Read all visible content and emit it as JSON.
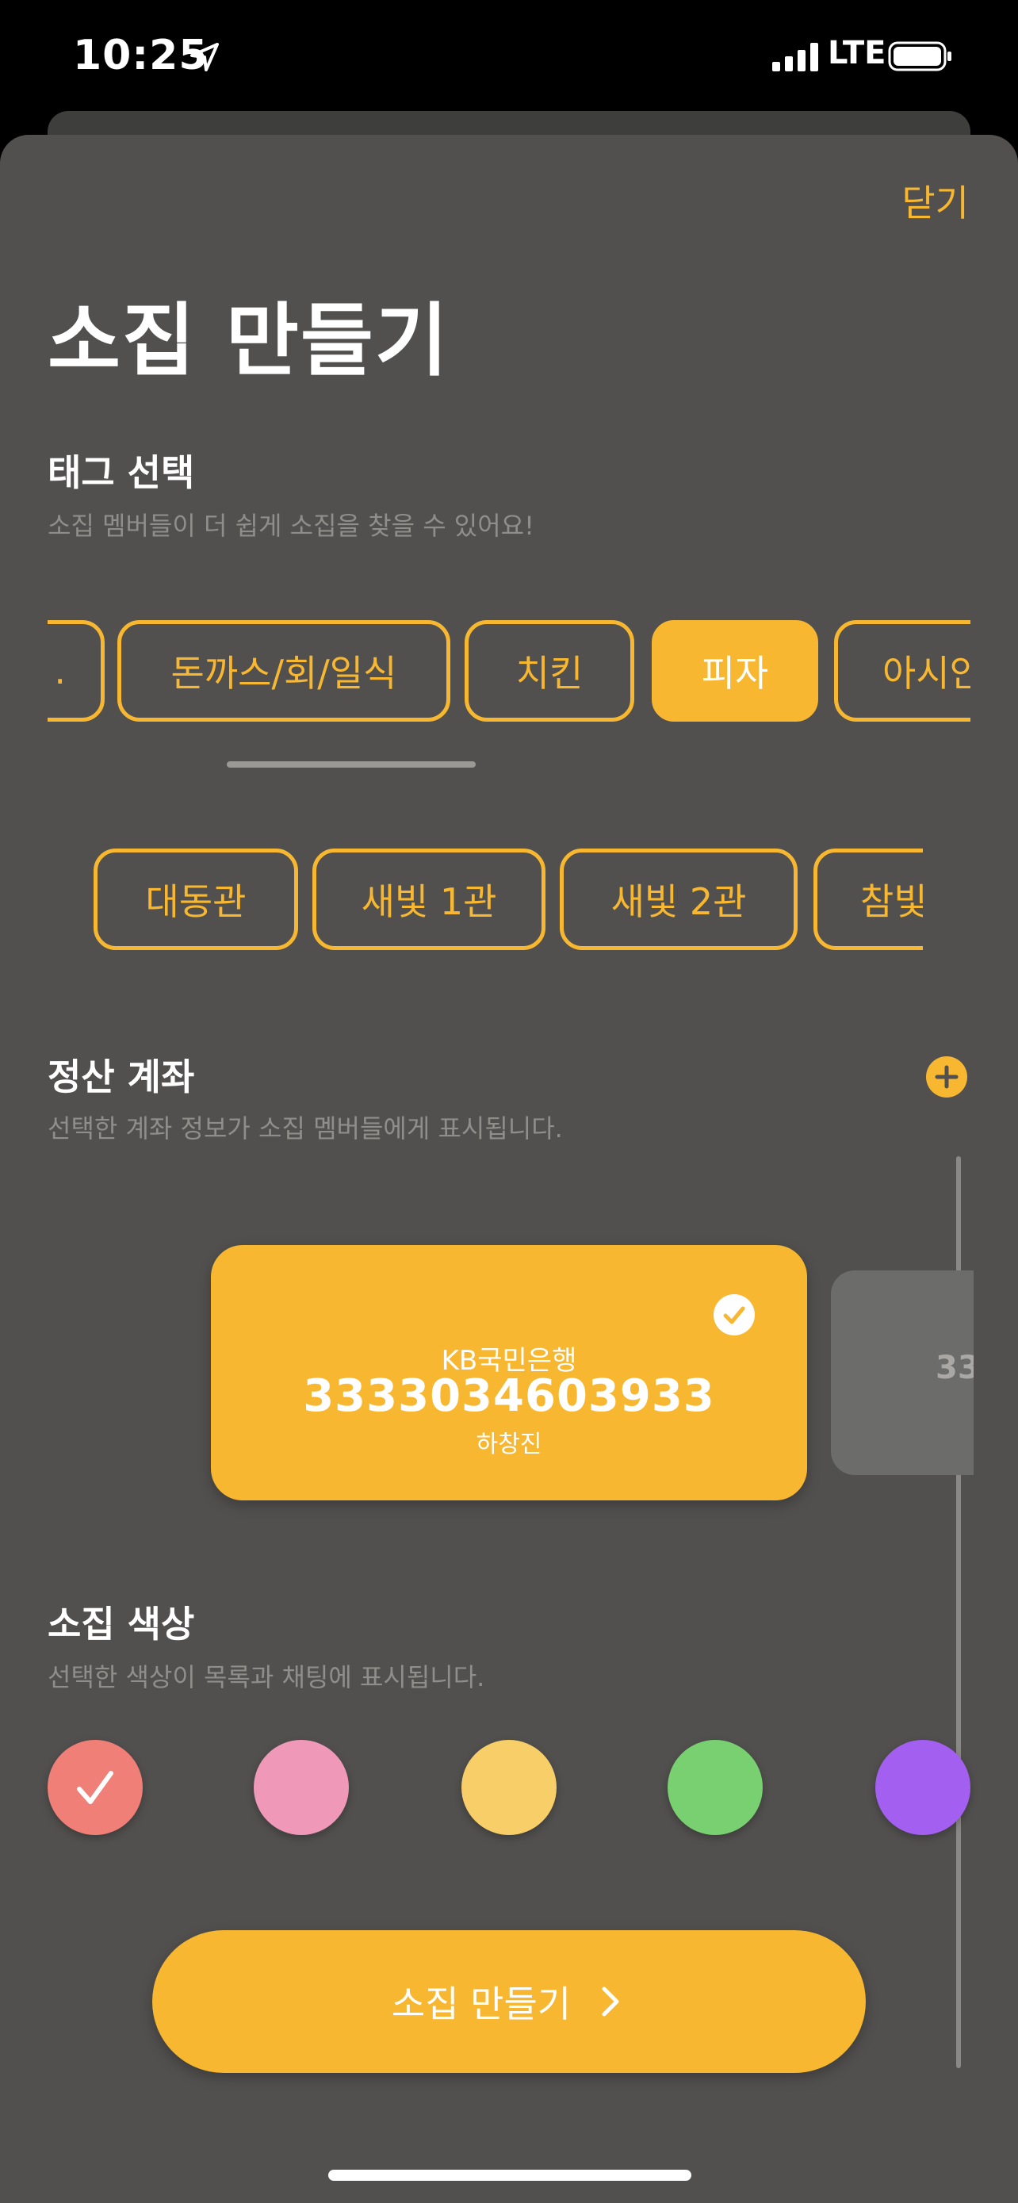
{
  "status_bar": {
    "time": "10:25",
    "network": "LTE",
    "icons": [
      "location-arrow-icon",
      "signal-icon",
      "battery-icon"
    ]
  },
  "header": {
    "close_label": "닫기",
    "title": "소집 만들기"
  },
  "tag_section": {
    "title": "태그 선택",
    "subtitle": "소집 멤버들이 더 쉽게 소집을 찾을 수 있어요!",
    "food_tags": [
      {
        "label": ".",
        "selected": false
      },
      {
        "label": "돈까스/회/일식",
        "selected": false
      },
      {
        "label": "치킨",
        "selected": false
      },
      {
        "label": "피자",
        "selected": true
      },
      {
        "label": "아시안",
        "selected": false
      }
    ],
    "place_tags": [
      {
        "label": "대동관",
        "selected": false
      },
      {
        "label": "새빛 1관",
        "selected": false
      },
      {
        "label": "새빛 2관",
        "selected": false
      },
      {
        "label": "참빛관",
        "selected": false
      }
    ]
  },
  "account_section": {
    "title": "정산 계좌",
    "subtitle": "선택한 계좌 정보가 소집 멤버들에게 표시됩니다.",
    "add_icon": "plus-icon",
    "accounts": [
      {
        "bank": "KB국민은행",
        "number": "3333034603933",
        "holder": "하창진",
        "selected": true
      },
      {
        "number_partial": "33"
      }
    ]
  },
  "color_section": {
    "title": "소집 색상",
    "subtitle": "선택한 색상이 목록과 채팅에 표시됩니다.",
    "swatches": [
      {
        "color": "#f07f78",
        "selected": true
      },
      {
        "color": "#ef98b8",
        "selected": false
      },
      {
        "color": "#f7ce67",
        "selected": false
      },
      {
        "color": "#78d071",
        "selected": false
      },
      {
        "color": "#a25ff0",
        "selected": false
      }
    ]
  },
  "cta": {
    "label": "소집 만들기",
    "icon": "chevron-right-icon"
  },
  "colors": {
    "accent": "#f8b731",
    "sheet_bg": "#51504e"
  }
}
